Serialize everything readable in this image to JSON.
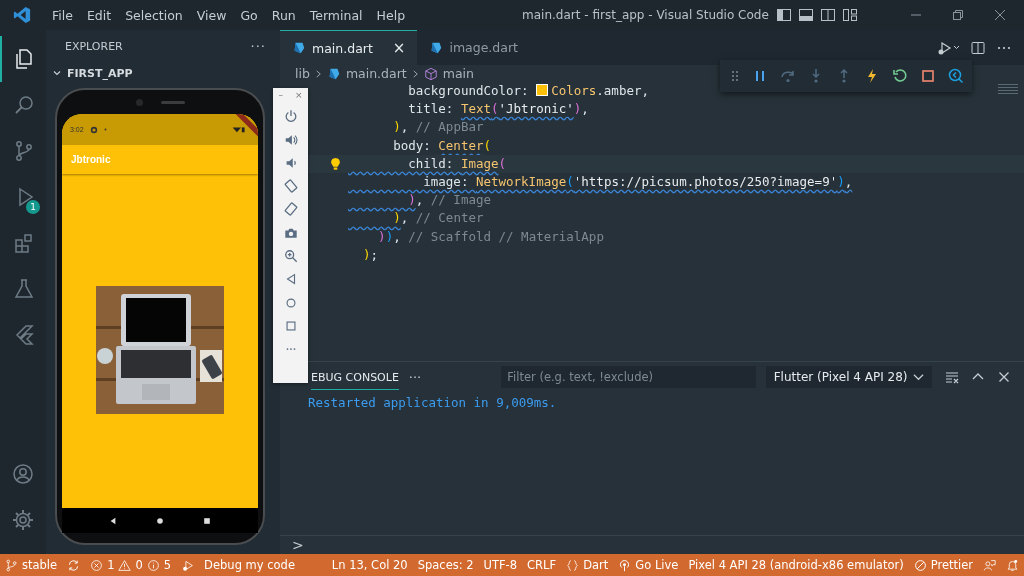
{
  "title_bar": {
    "menus": [
      "File",
      "Edit",
      "Selection",
      "View",
      "Go",
      "Run",
      "Terminal",
      "Help"
    ],
    "title": "main.dart - first_app - Visual Studio Code"
  },
  "activity_bar": {
    "items": [
      {
        "kind": "files",
        "selected": true
      },
      {
        "kind": "search",
        "selected": false
      },
      {
        "kind": "branch",
        "selected": false
      },
      {
        "kind": "debug",
        "selected": false,
        "badge": "1"
      },
      {
        "kind": "extensions",
        "selected": false
      },
      {
        "kind": "flask",
        "selected": false
      },
      {
        "kind": "flutter",
        "selected": false
      }
    ]
  },
  "sidebar": {
    "title": "EXPLORER",
    "more": "···",
    "folder": {
      "label": "FIRST_APP",
      "expanded": true
    }
  },
  "tabs": [
    {
      "label": "main.dart",
      "selected": true,
      "close": "×"
    },
    {
      "label": "image.dart",
      "selected": false
    }
  ],
  "breadcrumb": [
    "lib",
    "main.dart",
    "main"
  ],
  "code": [
    {
      "tokens": [
        {
          "text": "        backgroundColor: ",
          "kind": "plain"
        },
        {
          "text": "Colors",
          "kind": "class",
          "swatch": true
        },
        {
          "text": ".amber,",
          "kind": "plain"
        }
      ]
    },
    {
      "tokens": [
        {
          "text": "        title: ",
          "kind": "plain"
        },
        {
          "text": "Text",
          "kind": "class",
          "squiggle": true
        },
        {
          "text": "(",
          "kind": "paren2",
          "squiggle": true
        },
        {
          "text": "'Jbtronic'",
          "kind": "string",
          "squiggle": true
        },
        {
          "text": ")",
          "kind": "paren2"
        },
        {
          "text": ",",
          "kind": "plain"
        }
      ]
    },
    {
      "tokens": [
        {
          "text": "      )",
          "kind": "paren1"
        },
        {
          "text": ", ",
          "kind": "plain"
        },
        {
          "text": "// AppBar",
          "kind": "comment"
        }
      ]
    },
    {
      "tokens": [
        {
          "text": "      body: ",
          "kind": "plain"
        },
        {
          "text": "Center",
          "kind": "class",
          "squiggle": true
        },
        {
          "text": "(",
          "kind": "paren1"
        }
      ]
    },
    {
      "current": true,
      "hint": true,
      "tokens": [
        {
          "text": "        child: ",
          "kind": "plain",
          "squiggle": true
        },
        {
          "text": "Image",
          "kind": "class",
          "squiggle": true
        },
        {
          "text": "(",
          "kind": "paren2"
        }
      ]
    },
    {
      "tokens": [
        {
          "text": "          image: ",
          "kind": "plain",
          "squiggle": true
        },
        {
          "text": "NetworkImage",
          "kind": "class",
          "squiggle": true
        },
        {
          "text": "(",
          "kind": "paren3",
          "squiggle": true
        },
        {
          "text": "'https://picsum.photos/250?image=9'",
          "kind": "string",
          "squiggle": true
        },
        {
          "text": ")",
          "kind": "paren3",
          "squiggle": true
        },
        {
          "text": ",",
          "kind": "plain",
          "squiggle": true
        }
      ]
    },
    {
      "tokens": [
        {
          "text": "        )",
          "kind": "paren2",
          "squiggle": true
        },
        {
          "text": ", ",
          "kind": "plain"
        },
        {
          "text": "// Image",
          "kind": "comment"
        }
      ]
    },
    {
      "tokens": [
        {
          "text": "      )",
          "kind": "paren1",
          "squiggle": true
        },
        {
          "text": ", ",
          "kind": "plain"
        },
        {
          "text": "// Center",
          "kind": "comment"
        }
      ]
    },
    {
      "tokens": [
        {
          "text": "    )",
          "kind": "paren2"
        },
        {
          "text": ")",
          "kind": "paren3"
        },
        {
          "text": ", ",
          "kind": "plain"
        },
        {
          "text": "// Scaffold // MaterialApp",
          "kind": "comment"
        }
      ]
    },
    {
      "tokens": [
        {
          "text": "  )",
          "kind": "paren1"
        },
        {
          "text": ";",
          "kind": "plain"
        }
      ]
    }
  ],
  "emulator": {
    "time": "3:02",
    "app_title": "Jbtronic",
    "toolbar": {
      "minimize": "–",
      "close": "×",
      "buttons": [
        {
          "kind": "power"
        },
        {
          "kind": "volume-up"
        },
        {
          "kind": "volume-down"
        },
        {
          "kind": "rotate-left"
        },
        {
          "kind": "rotate-right"
        },
        {
          "kind": "camera"
        },
        {
          "kind": "zoom"
        },
        {
          "kind": "back"
        },
        {
          "kind": "home"
        },
        {
          "kind": "overview"
        },
        {
          "kind": "more"
        }
      ]
    }
  },
  "panel": {
    "tab": "EBUG CONSOLE",
    "more": "···",
    "filter": {
      "placeholder": "Filter (e.g. text, !exclude)"
    },
    "session": "Flutter (Pixel 4 API 28)",
    "output": [
      "Restarted application in 9,009ms."
    ],
    "prompt": ">"
  },
  "status_bar": [
    {
      "kind": "branch",
      "text": "stable"
    },
    {
      "kind": "sync"
    },
    {
      "kind": "problems",
      "errors": "1",
      "warnings": "0",
      "infos": "5"
    },
    {
      "kind": "debug"
    },
    {
      "kind": "text",
      "text": "Debug my code"
    },
    {
      "kind": "text",
      "text": "Ln 13, Col 20"
    },
    {
      "kind": "text",
      "text": "Spaces: 2"
    },
    {
      "kind": "text",
      "text": "UTF-8"
    },
    {
      "kind": "text",
      "text": "CRLF"
    },
    {
      "kind": "braces",
      "text": "Dart"
    },
    {
      "kind": "golive",
      "text": "Go Live"
    },
    {
      "kind": "text",
      "text": "Pixel 4 API 28 (android-x86 emulator)"
    },
    {
      "kind": "prettier",
      "text": "Prettier"
    },
    {
      "kind": "feedback"
    },
    {
      "kind": "bell"
    }
  ]
}
